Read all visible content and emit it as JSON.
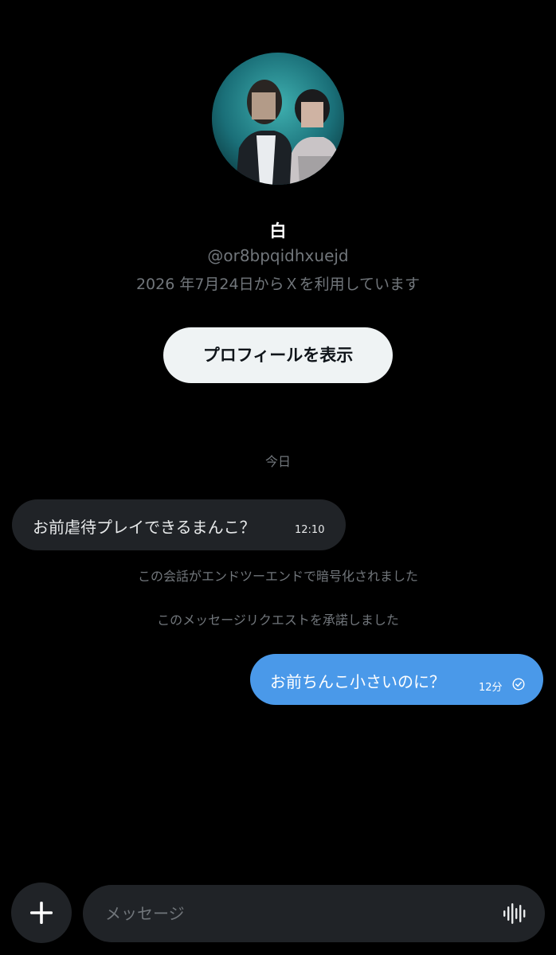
{
  "profile": {
    "display_name": "白",
    "handle": "@or8bpqidhxuejd",
    "joined": "2026 年7月24日からＸを利用しています",
    "view_profile_label": "プロフィールを表示"
  },
  "conversation": {
    "date_separator": "今日",
    "messages": [
      {
        "direction": "incoming",
        "text": "お前虐待プレイできるまんこ？",
        "time": "12:10"
      },
      {
        "direction": "outgoing",
        "text": "お前ちんこ小さいのに？",
        "time": "12分",
        "status_icon": "sent-check-icon"
      }
    ],
    "system_notes": [
      "この会話がエンドツーエンドで暗号化されました",
      "このメッセージリクエストを承諾しました"
    ]
  },
  "composer": {
    "placeholder": "メッセージ",
    "value": ""
  },
  "icons": {
    "add": "plus-icon",
    "voice": "voice-waveform-icon",
    "status": "check-circle-icon"
  },
  "colors": {
    "background": "#000000",
    "incoming_bubble": "#202327",
    "outgoing_bubble": "#4a99e9",
    "secondary_text": "#71767b",
    "button_bg": "#eff3f4"
  }
}
